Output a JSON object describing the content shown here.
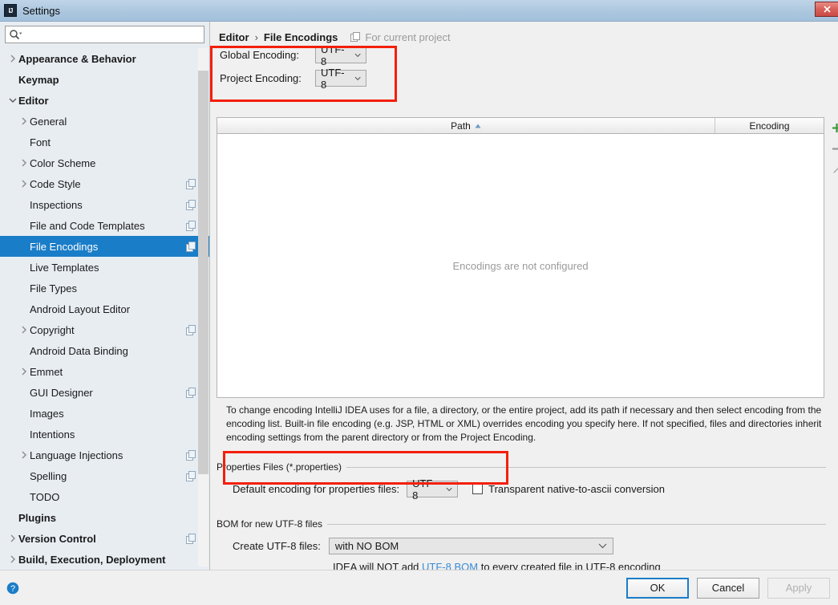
{
  "window": {
    "title": "Settings",
    "app_icon": "intellij-idea-icon",
    "close_label": "✕"
  },
  "search": {
    "value": "",
    "placeholder": ""
  },
  "sidebar": {
    "items": [
      {
        "label": "Appearance & Behavior",
        "level": 1,
        "bold": true,
        "arrow": "collapsed",
        "badge": false,
        "selected": false
      },
      {
        "label": "Keymap",
        "level": 1,
        "bold": true,
        "arrow": "none",
        "badge": false,
        "selected": false
      },
      {
        "label": "Editor",
        "level": 1,
        "bold": true,
        "arrow": "expanded",
        "badge": false,
        "selected": false
      },
      {
        "label": "General",
        "level": 2,
        "bold": false,
        "arrow": "collapsed",
        "badge": false,
        "selected": false
      },
      {
        "label": "Font",
        "level": 2,
        "bold": false,
        "arrow": "none",
        "badge": false,
        "selected": false
      },
      {
        "label": "Color Scheme",
        "level": 2,
        "bold": false,
        "arrow": "collapsed",
        "badge": false,
        "selected": false
      },
      {
        "label": "Code Style",
        "level": 2,
        "bold": false,
        "arrow": "collapsed",
        "badge": true,
        "selected": false
      },
      {
        "label": "Inspections",
        "level": 2,
        "bold": false,
        "arrow": "none",
        "badge": true,
        "selected": false
      },
      {
        "label": "File and Code Templates",
        "level": 2,
        "bold": false,
        "arrow": "none",
        "badge": true,
        "selected": false
      },
      {
        "label": "File Encodings",
        "level": 2,
        "bold": false,
        "arrow": "none",
        "badge": true,
        "selected": true
      },
      {
        "label": "Live Templates",
        "level": 2,
        "bold": false,
        "arrow": "none",
        "badge": false,
        "selected": false
      },
      {
        "label": "File Types",
        "level": 2,
        "bold": false,
        "arrow": "none",
        "badge": false,
        "selected": false
      },
      {
        "label": "Android Layout Editor",
        "level": 2,
        "bold": false,
        "arrow": "none",
        "badge": false,
        "selected": false
      },
      {
        "label": "Copyright",
        "level": 2,
        "bold": false,
        "arrow": "collapsed",
        "badge": true,
        "selected": false
      },
      {
        "label": "Android Data Binding",
        "level": 2,
        "bold": false,
        "arrow": "none",
        "badge": false,
        "selected": false
      },
      {
        "label": "Emmet",
        "level": 2,
        "bold": false,
        "arrow": "collapsed",
        "badge": false,
        "selected": false
      },
      {
        "label": "GUI Designer",
        "level": 2,
        "bold": false,
        "arrow": "none",
        "badge": true,
        "selected": false
      },
      {
        "label": "Images",
        "level": 2,
        "bold": false,
        "arrow": "none",
        "badge": false,
        "selected": false
      },
      {
        "label": "Intentions",
        "level": 2,
        "bold": false,
        "arrow": "none",
        "badge": false,
        "selected": false
      },
      {
        "label": "Language Injections",
        "level": 2,
        "bold": false,
        "arrow": "collapsed",
        "badge": true,
        "selected": false
      },
      {
        "label": "Spelling",
        "level": 2,
        "bold": false,
        "arrow": "none",
        "badge": true,
        "selected": false
      },
      {
        "label": "TODO",
        "level": 2,
        "bold": false,
        "arrow": "none",
        "badge": false,
        "selected": false
      },
      {
        "label": "Plugins",
        "level": 1,
        "bold": true,
        "arrow": "none",
        "badge": false,
        "selected": false
      },
      {
        "label": "Version Control",
        "level": 1,
        "bold": true,
        "arrow": "collapsed",
        "badge": true,
        "selected": false
      },
      {
        "label": "Build, Execution, Deployment",
        "level": 1,
        "bold": true,
        "arrow": "collapsed",
        "badge": false,
        "selected": false
      }
    ]
  },
  "breadcrumb": {
    "parent": "Editor",
    "separator": "›",
    "current": "File Encodings",
    "note": "For current project",
    "note_icon": "project-scope-icon"
  },
  "encodings": {
    "global_label": "Global Encoding:",
    "global_value": "UTF-8",
    "project_label": "Project Encoding:",
    "project_value": "UTF-8"
  },
  "table": {
    "columns": [
      "Path",
      "Encoding"
    ],
    "sort_column": "Path",
    "sort_direction": "ascending",
    "rows": [],
    "empty_text": "Encodings are not configured",
    "tools": [
      "add-icon",
      "remove-icon",
      "edit-icon"
    ]
  },
  "description": "To change encoding IntelliJ IDEA uses for a file, a directory, or the entire project, add its path if necessary and then select encoding from the encoding list. Built-in file encoding (e.g. JSP, HTML or XML) overrides encoding you specify here. If not specified, files and directories inherit encoding settings from the parent directory or from the Project Encoding.",
  "properties_group": {
    "title": "Properties Files (*.properties)",
    "default_encoding_label": "Default encoding for properties files:",
    "default_encoding_value": "UTF-8",
    "transparent_label": "Transparent native-to-ascii conversion",
    "transparent_checked": false
  },
  "bom_group": {
    "title": "BOM for new UTF-8 files",
    "create_label": "Create UTF-8 files:",
    "create_value": "with NO BOM",
    "hint_prefix": "IDEA will NOT add ",
    "hint_link": "UTF-8 BOM",
    "hint_suffix": " to every created file in UTF-8 encoding"
  },
  "footer": {
    "help_icon": "help-icon",
    "ok_label": "OK",
    "cancel_label": "Cancel",
    "apply_label": "Apply",
    "apply_disabled": true
  },
  "annotations": {
    "color": "#f41f0c",
    "boxes": [
      "global-and-project-encoding",
      "properties-default-encoding"
    ]
  }
}
